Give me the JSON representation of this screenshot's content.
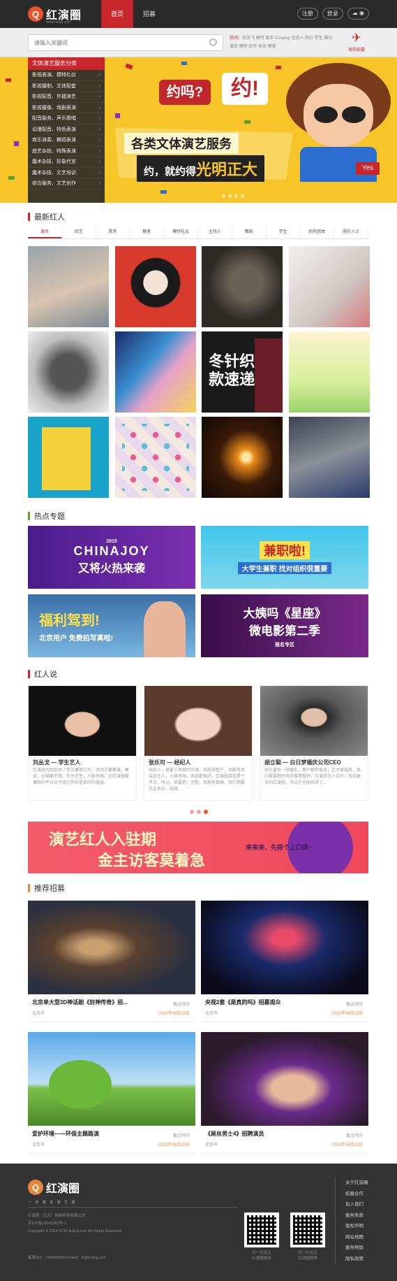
{
  "header": {
    "logo_mark": "Q",
    "logo_text": "红演圈",
    "logo_sub": "www.hotyq.com",
    "nav": [
      "首页",
      "招募"
    ],
    "links": [
      "注册",
      "登录",
      "☁ ◉"
    ]
  },
  "search": {
    "placeholder": "请输入关键词",
    "hot_label": "热词：",
    "hot_words": "去张飞 模特 歌手 Cosplay 主持人 同公 学生 腾讯演员 模特 知乎 化妆 舞者",
    "publish_label": "发布招募"
  },
  "banner": {
    "menu_title": "文体演艺服务分类",
    "menu": [
      "影视表演、模特礼仪",
      "影视摄制、文体配套",
      "影视配音、外籍演艺",
      "影视摄像、戏剧表演",
      "配音服务、声乐歌唱",
      "动漫配音、特色表演",
      "商乐演奏、舞蹈表演",
      "曲艺杂技、特殊表演",
      "魔术杂技、形象代言",
      "魔术杂技、文艺培训",
      "综合服务、文艺创作"
    ],
    "bubble1": "约吗?",
    "bubble2": "约!",
    "slogan1": "各类文体演艺服务",
    "slogan2": "约，就约得",
    "slogan2_em": "光明正大",
    "badge": "Yes"
  },
  "new_talent": {
    "title": "最新红人",
    "filters": [
      "演员",
      "综艺",
      "歌手",
      "舞者",
      "模特礼仪",
      "主持人",
      "舞蹈",
      "学生",
      "机构团体",
      "圈外人士"
    ]
  },
  "photo_overlay": {
    "title": "冬针织",
    "sub": "款速递"
  },
  "topics": {
    "title": "热点专题",
    "items": [
      {
        "main": "CHINAJOY",
        "sub": "又将火热来袭",
        "tag": "2015"
      },
      {
        "main": "兼职啦!",
        "sub": "大学生兼职 找对组织很重要"
      },
      {
        "main": "福利驾到!",
        "sub": "北京用户 免费拍写真啦!"
      },
      {
        "main": "大姨吗《星座》",
        "sub": "微电影第二季",
        "tag": "报名专区"
      }
    ]
  },
  "talk": {
    "title": "红人说",
    "items": [
      {
        "name": "刘丛戈 — 学生艺人",
        "desc": "红演圈为我提供了多次兼职工作，活动方便靠谱，聚拢，价格都不错。作为学生，人脉有限，在红演圈做兼职的平台对于我们年轻是很好的选择。"
      },
      {
        "name": "张乐可 — 经纪人",
        "desc": "经纪人，需要三项目的沟通，功能来看户，功能有其会员艺人，人脉有限，商品都很好，红演圈目前是个平台，所以，但要把、完整，就能有数据，我们想要在此有价、选择。"
      },
      {
        "name": "胡立聪 — 白日梦婚庆公司CEO",
        "desc": "现在要有一班婚礼，客户都有需求，艺术家服务，我们需要把所有的事情做好，与演员艺人合作，找到更多的红演圈，可以在全国找得了。"
      }
    ]
  },
  "ad": {
    "line1": "演艺红人入驻期",
    "line2": "金主访客莫着急",
    "side": "来来来，先报个上口碑~"
  },
  "recruit": {
    "title": "推荐招募",
    "deadline_label": "截止时间",
    "items": [
      {
        "title": "北京单大型3D神话剧《封神传奇》招...",
        "city": "北京市",
        "date": "2015年05月23日"
      },
      {
        "title": "央视2套《是真的吗》招募观众",
        "city": "北京市",
        "date": "2015年04月23日"
      },
      {
        "title": "爱护环境——环保主题路演",
        "city": "北京市",
        "date": "2015年05月23日"
      },
      {
        "title": "《屌丝男士4》招聘演员",
        "city": "北京市",
        "date": "2015年04月23日"
      }
    ]
  },
  "footer": {
    "logo_mark": "Q",
    "logo_text": "红演圈",
    "slogan": "一 步 踏 进 演 艺 圈",
    "info": [
      "红演圈（北京）网络科技有限公司",
      "京ICP备15045983号-1",
      "Copyright © 2014-2015 Hotyq.com All Rights Reserved"
    ],
    "contact": "客服QQ：2184669003    Email：kf@hotyq.com",
    "qr1": "扫一扫关注\n红演圈微信",
    "qr2": "扫一扫关注\n红演圈微博",
    "links": [
      "关于红演圈",
      "招募合作",
      "加入我们",
      "服务条款",
      "版权声明",
      "网站地图",
      "服务帮助",
      "隐私政策"
    ]
  },
  "colors": {
    "brand_red": "#c9262c",
    "accent_orange": "#e8873c",
    "header_bg": "#2a2a2a",
    "footer_bg": "#333333"
  }
}
